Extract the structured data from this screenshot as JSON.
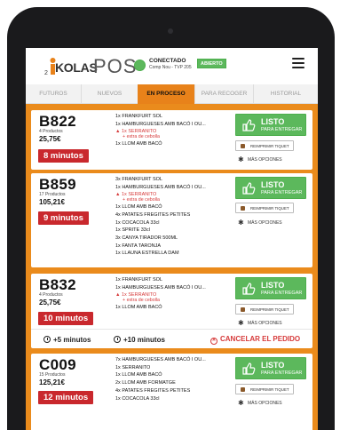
{
  "header": {
    "logo_small": "2",
    "logo_brand": "KOLAS",
    "logo_pos": "POS",
    "status_label": "CONECTADO",
    "status_sub": "Comp Nou - TVP 205",
    "open_badge": "ABIERTO",
    "colors": {
      "accent": "#e8821a",
      "connected": "#5cb85c",
      "alert": "#c9282d"
    }
  },
  "tabs": [
    {
      "label": "FUTUROS",
      "active": false
    },
    {
      "label": "NUEVOS",
      "active": false
    },
    {
      "label": "EN PROCESO",
      "active": true
    },
    {
      "label": "PARA RECOGER",
      "active": false
    },
    {
      "label": "HISTORIAL",
      "active": false
    }
  ],
  "orders": [
    {
      "code": "B822",
      "products": "4 Productos",
      "price": "25,75€",
      "minutes": "8 minutos",
      "items": [
        {
          "text": "1x FRANKFURT SOL",
          "warn": false
        },
        {
          "text": "1x HAMBURGUESES AMB BACÓ I OU...",
          "warn": false
        },
        {
          "text": "1x SERRANITO",
          "warn": true,
          "note": "+ extra de cebolla"
        },
        {
          "text": "1x LLOM AMB BACÓ",
          "warn": false
        }
      ]
    },
    {
      "code": "B859",
      "products": "17 Productos",
      "price": "105,21€",
      "minutes": "9 minutos",
      "items": [
        {
          "text": "3x FRANKFURT SOL",
          "warn": false
        },
        {
          "text": "1x HAMBURGUESES AMB BACÓ I OU...",
          "warn": false
        },
        {
          "text": "1x SERRANITO",
          "warn": true,
          "note": "+ extra de cebolla"
        },
        {
          "text": "1x LLOM AMB BACÓ",
          "warn": false
        },
        {
          "text": "4x PATATES FREGITES PETITES",
          "warn": false
        },
        {
          "text": "1x COCACOLA 33cl",
          "warn": false
        },
        {
          "text": "1x SPRITE 33cl",
          "warn": false
        },
        {
          "text": "3x CANYA TIRADOR 500ML",
          "warn": false
        },
        {
          "text": "1x FANTA TARONJA",
          "warn": false
        },
        {
          "text": "1x LLAUNA ESTRELLA DAM",
          "warn": false
        }
      ]
    },
    {
      "code": "B832",
      "products": "4 Productos",
      "price": "25,75€",
      "minutes": "10 minutos",
      "items": [
        {
          "text": "1x FRANKFURT SOL",
          "warn": false
        },
        {
          "text": "1x HAMBURGUESES AMB BACÓ I OU...",
          "warn": false
        },
        {
          "text": "1x SERRANITO",
          "warn": true,
          "note": "+ extra de cebolla"
        },
        {
          "text": "1x LLOM AMB BACÓ",
          "warn": false
        }
      ],
      "actions": {
        "plus5": "+5 minutos",
        "plus10": "+10 minutos",
        "cancel": "CANCELAR EL PEDIDO"
      }
    },
    {
      "code": "C009",
      "products": "15 Productos",
      "price": "125,21€",
      "minutes": "12 minutos",
      "items": [
        {
          "text": "7x HAMBURGUESES AMB BACÓ I OU...",
          "warn": false
        },
        {
          "text": "1x SERRANITO",
          "warn": false
        },
        {
          "text": "1x LLOM AMB BACÓ",
          "warn": false
        },
        {
          "text": "2x LLOM AMB FORMATGE",
          "warn": false
        },
        {
          "text": "4x PATATES FREGITES PETITES",
          "warn": false
        },
        {
          "text": "1x COCACOLA 33cl",
          "warn": false
        }
      ]
    }
  ],
  "buttons": {
    "ready_l1": "LISTO",
    "ready_l2": "PARA ENTREGAR",
    "reprint": "REIMPRIMIR TIQUET",
    "more": "MÁS OPCIONES"
  },
  "icons": {
    "ready": "thumbs-up-icon",
    "reprint": "ticket-icon",
    "more": "gear-icon",
    "menu": "hamburger-menu-icon",
    "clock": "clock-icon",
    "cancel": "cancel-circle-icon"
  }
}
